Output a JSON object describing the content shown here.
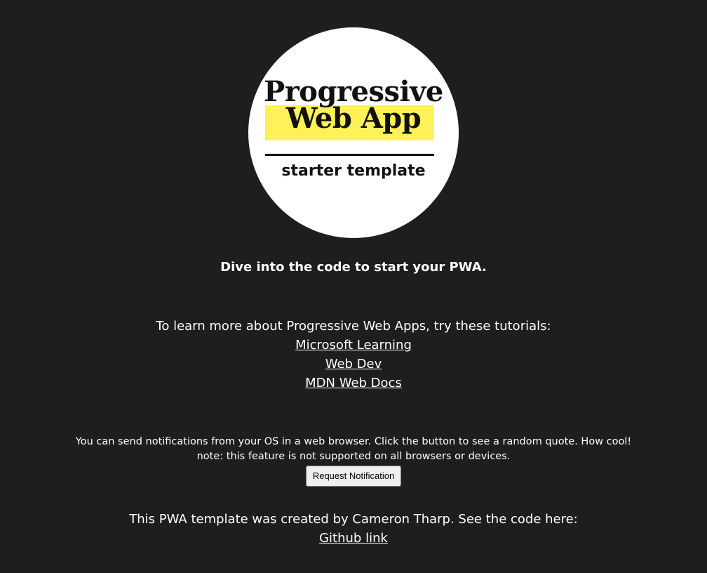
{
  "logo": {
    "line1": "Progressive",
    "line2": "Web App",
    "line3": "starter template",
    "highlight_color": "#fff157"
  },
  "tagline": "Dive into the code to start your PWA.",
  "learn": {
    "intro": "To learn more about Progressive Web Apps, try these tutorials:",
    "links": [
      {
        "label": "Microsoft Learning"
      },
      {
        "label": "Web Dev"
      },
      {
        "label": "MDN Web Docs"
      }
    ]
  },
  "notifications": {
    "text": "You can send notifications from your OS in a web browser. Click the button to see a random quote. How cool!",
    "note": "note: this feature is not supported on all browsers or devices.",
    "button_label": "Request Notification"
  },
  "credit": {
    "text": "This PWA template was created by Cameron Tharp. See the code here:",
    "link_label": "Github link"
  },
  "colors": {
    "background": "#1e1e1e",
    "text": "#ffffff"
  }
}
